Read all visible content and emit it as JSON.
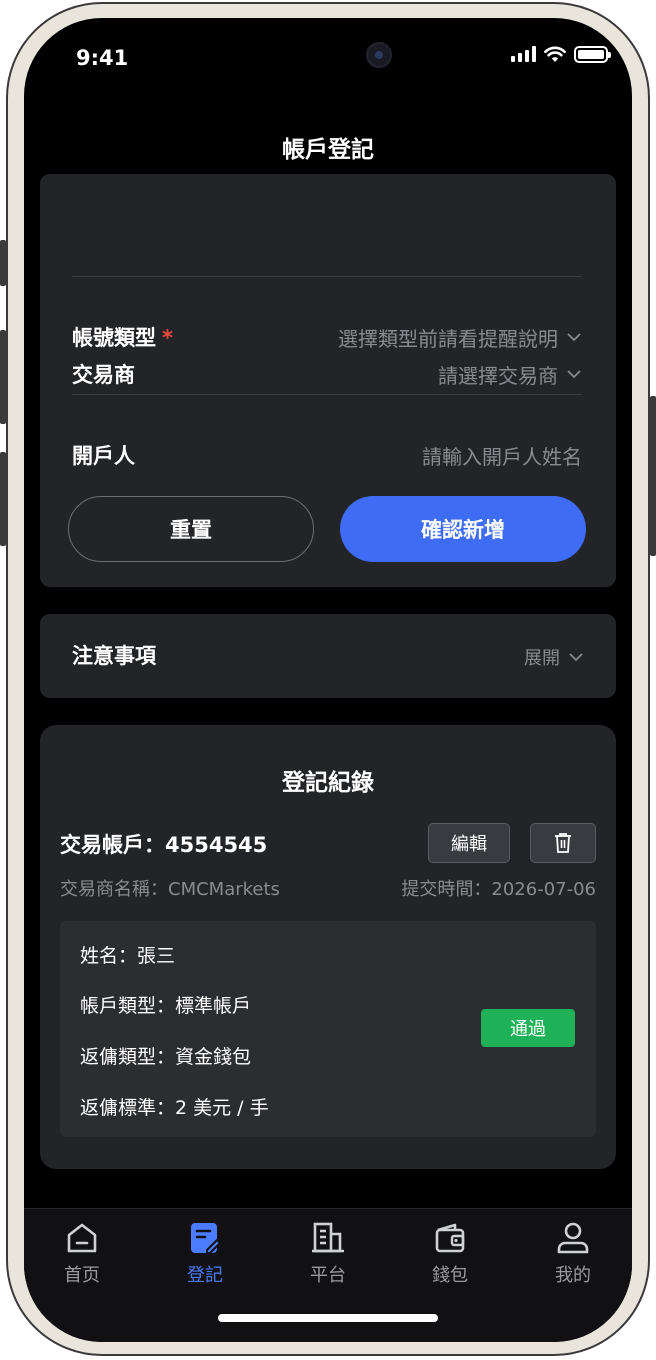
{
  "status_bar": {
    "time": "9:41"
  },
  "header": {
    "title": "帳戶登記"
  },
  "form": {
    "broker": {
      "label": "交易商",
      "placeholder": "請選擇交易商"
    },
    "account_type": {
      "label": "帳號類型",
      "required_mark": "*",
      "placeholder": "選擇類型前請看提醒說明"
    },
    "account_holder": {
      "label": "開戶人",
      "placeholder": "請輸入開戶人姓名"
    },
    "reset_label": "重置",
    "confirm_label": "確認新增",
    "accent_color": "#3f6cf4"
  },
  "notice": {
    "label": "注意事項",
    "expand_label": "展開"
  },
  "records": {
    "title": "登記紀錄",
    "items": [
      {
        "account": "交易帳戶：4554545",
        "edit_label": "編輯",
        "broker_name": "交易商名稱：CMCMarkets",
        "submit_time": "提交時間：2026-07-06",
        "name": "姓名：張三",
        "account_type": "帳戶類型：標準帳戶",
        "rebate_type": "返傭類型：資金錢包",
        "rebate_standard": "返傭標準：2 美元 / 手",
        "status": "通過",
        "status_color": "#1fb157"
      }
    ]
  },
  "tabbar": {
    "active_index": 1,
    "active_color": "#4b7bff",
    "items": [
      {
        "label": "首页",
        "icon": "home-icon"
      },
      {
        "label": "登記",
        "icon": "register-icon"
      },
      {
        "label": "平台",
        "icon": "building-icon"
      },
      {
        "label": "錢包",
        "icon": "wallet-icon"
      },
      {
        "label": "我的",
        "icon": "user-icon"
      }
    ]
  }
}
